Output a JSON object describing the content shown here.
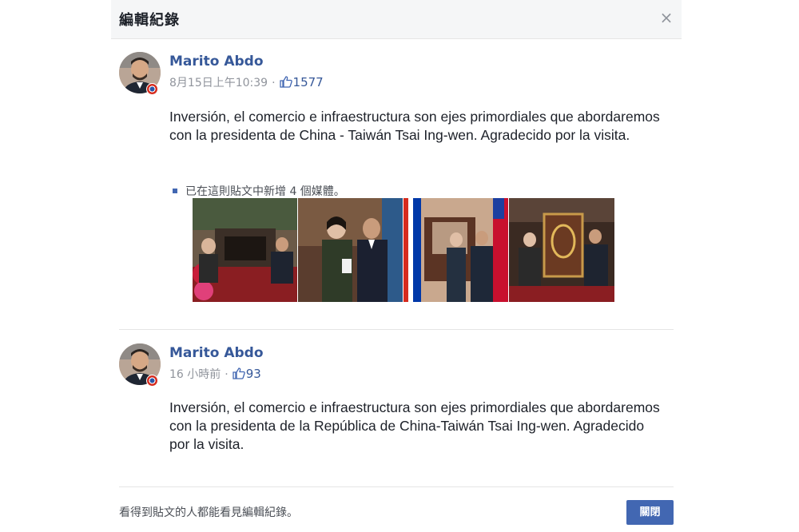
{
  "dialog": {
    "title": "編輯紀錄",
    "close_symbol": "×"
  },
  "entries": [
    {
      "author": "Marito Abdo",
      "timestamp": "8月15日上午10:39",
      "separator": "·",
      "likes": "1577",
      "text": "Inversión, el comercio e infraestructura son ejes primordiales que abordaremos con la presidenta de China - Taiwán Tsai Ing-wen. Agradecido por la visita.",
      "media_note": "已在這則貼文中新增 4 個媒體。"
    },
    {
      "author": "Marito Abdo",
      "timestamp": "16 小時前",
      "separator": "·",
      "likes": "93",
      "text": "Inversión, el comercio e infraestructura son ejes primordiales que abordaremos con la presidenta de la República de China-Taiwán Tsai Ing-wen. Agradecido por la visita."
    }
  ],
  "footer": {
    "note": "看得到貼文的人都能看見編輯紀錄。",
    "close_label": "關閉"
  },
  "icons": {
    "like": "thumbs-up-icon",
    "close": "close-icon",
    "badge": "verified-flag-badge-icon"
  },
  "colors": {
    "link_blue": "#365899",
    "primary_button": "#4267b2",
    "header_bg": "#f5f6f7",
    "meta_gray": "#90949c"
  }
}
